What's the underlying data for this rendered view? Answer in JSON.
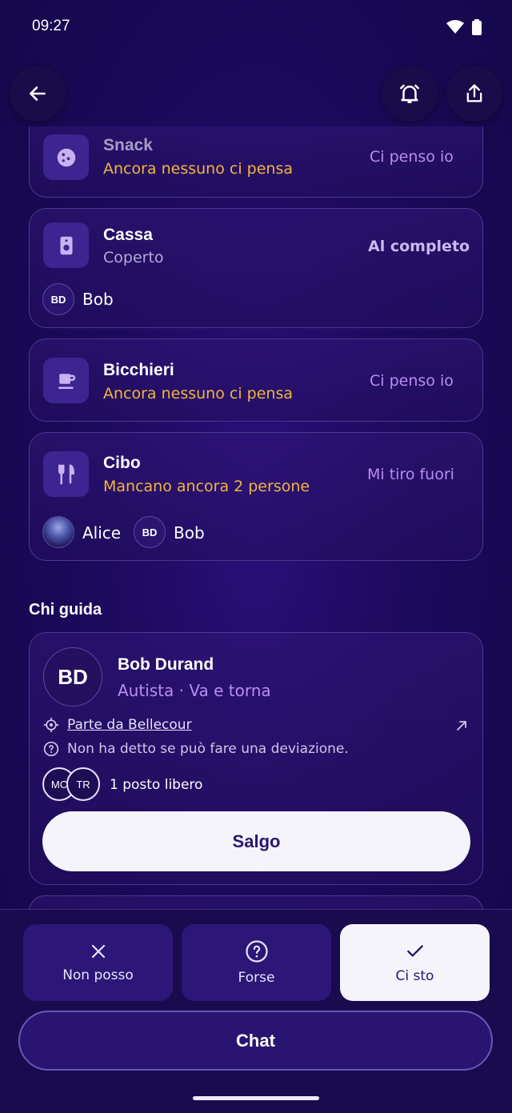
{
  "status": {
    "time": "09:27"
  },
  "items": [
    {
      "title": "Snack",
      "subtitle": "Ancora nessuno ci pensa",
      "action": "Ci penso io"
    },
    {
      "title": "Cassa",
      "subtitle": "Coperto",
      "action": "Al completo",
      "people": [
        {
          "initials": "BD",
          "name": "Bob"
        }
      ]
    },
    {
      "title": "Bicchieri",
      "subtitle": "Ancora nessuno ci pensa",
      "action": "Ci penso io"
    },
    {
      "title": "Cibo",
      "subtitle": "Mancano ancora 2 persone",
      "action": "Mi tiro fuori",
      "people": [
        {
          "name": "Alice"
        },
        {
          "initials": "BD",
          "name": "Bob"
        }
      ]
    }
  ],
  "drivers": {
    "title": "Chi guida",
    "driver": {
      "initials": "BD",
      "name": "Bob Durand",
      "role": "Autista · Va e torna",
      "departure": "Parte da Bellecour",
      "detour": "Non ha detto se può fare una deviazione.",
      "passengers": [
        "MC",
        "TR"
      ],
      "seats": "1 posto libero",
      "join_label": "Salgo"
    }
  },
  "rsvp": {
    "no": "Non posso",
    "maybe": "Forse",
    "yes": "Ci sto"
  },
  "chat_label": "Chat",
  "colors": {
    "accent": "#b78ef0",
    "warning": "#f3b53c",
    "background": "#1c0a5c"
  }
}
